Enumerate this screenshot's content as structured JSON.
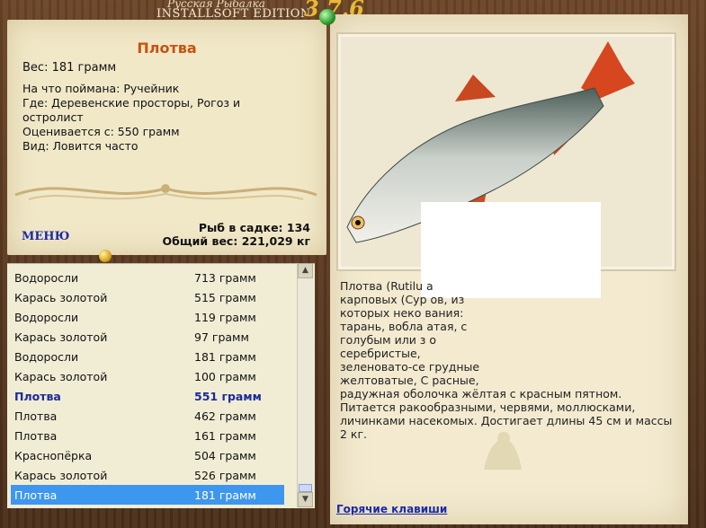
{
  "header": {
    "game_name": "Русская Рыбалка",
    "edition": "INSTALLSOFT EDITION",
    "version": "3.7.6"
  },
  "fish_card": {
    "name": "Плотва",
    "weight": "Вес: 181 грамм",
    "caught_on": "На что поймана: Ручейник",
    "where_line1": "Где: Деревенские просторы, Рогоз и",
    "where_line2": "остролист",
    "value": "Оценивается с: 550 грамм",
    "kind": "Вид: Ловится часто"
  },
  "menu_label": "МЕНЮ",
  "stats": {
    "in_keepnet": "Рыб в садке: 134",
    "total_weight": "Общий вес: 221,029 кг"
  },
  "catch_list": [
    {
      "name": "Водоросли",
      "weight": "713 грамм"
    },
    {
      "name": "Карась золотой",
      "weight": "515 грамм"
    },
    {
      "name": "Водоросли",
      "weight": "119 грамм"
    },
    {
      "name": "Карась золотой",
      "weight": "97 грамм"
    },
    {
      "name": "Водоросли",
      "weight": "181 грамм"
    },
    {
      "name": "Карась золотой",
      "weight": "100 грамм"
    },
    {
      "name": "Плотва",
      "weight": "551 грамм"
    },
    {
      "name": "Плотва",
      "weight": "462 грамм"
    },
    {
      "name": "Плотва",
      "weight": "161 грамм"
    },
    {
      "name": "Краснопёрка",
      "weight": "504 грамм"
    },
    {
      "name": "Карась золотой",
      "weight": "526 грамм"
    },
    {
      "name": "Плотва",
      "weight": "181 грамм"
    }
  ],
  "description_lines": [
    "Плотва (Rutilu                                           а",
    "карповых (Сур                                          ов, из",
    "которых неко                                         вания:",
    "тарань, вобла                                        атая, с",
    "голубым или з                                          о",
    "серебристые,                                           ",
    "зеленовато-се                                      грудные",
    "желтоватые, С                                      расные,",
    "радужная оболочка жёлтая с красным пятном.",
    "Питается ракообразными, червями, моллюсками,",
    "личинками насекомых. Достигает длины 45 см и массы",
    "2 кг."
  ],
  "hotkeys_link": "Горячие клавиши",
  "colors": {
    "accent": "#c8520f",
    "link": "#1a2aa8",
    "selection": "#3d97ee"
  }
}
